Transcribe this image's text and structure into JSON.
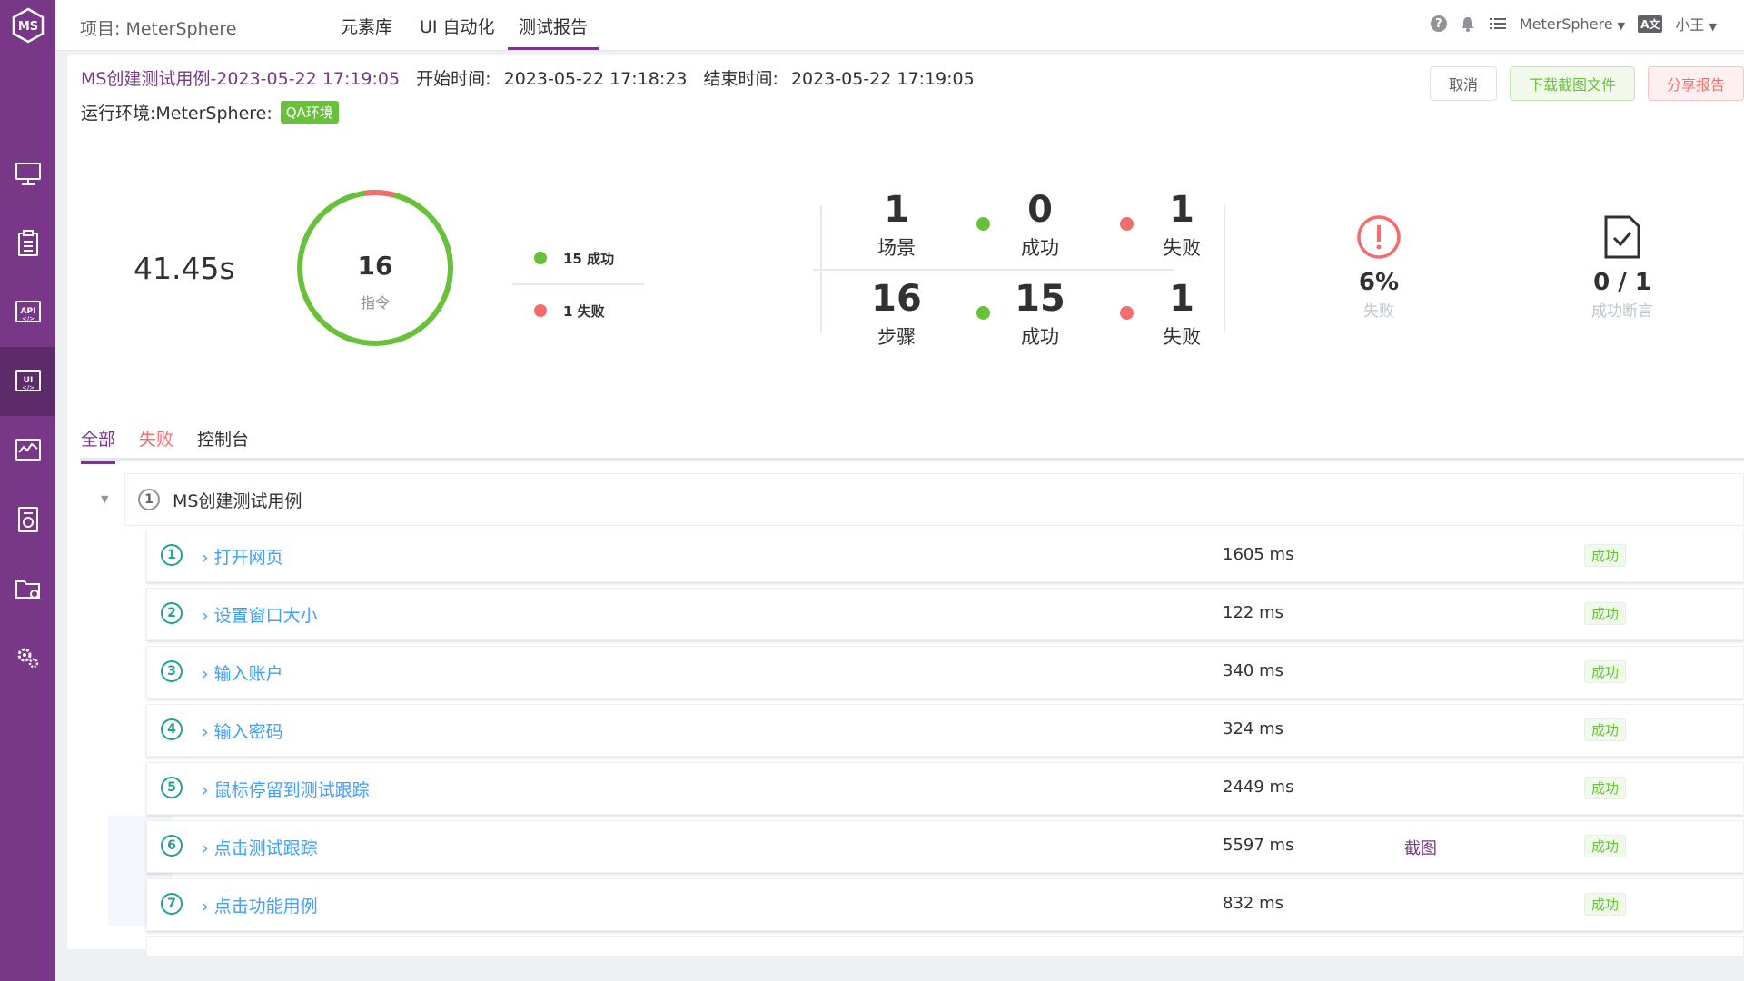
{
  "topbar": {
    "project_label": "项目: MeterSphere",
    "tabs": [
      {
        "label": "元素库",
        "active": false
      },
      {
        "label": "UI 自动化",
        "active": false
      },
      {
        "label": "测试报告",
        "active": true
      }
    ],
    "workspace": "MeterSphere",
    "user": "小王",
    "lang_icon_text": "A文"
  },
  "sidebar": {
    "logo_text": "MS",
    "items": [
      {
        "icon": "monitor-icon"
      },
      {
        "icon": "clipboard-icon"
      },
      {
        "icon": "api-icon",
        "text": "API"
      },
      {
        "icon": "ui-icon",
        "text": "UI",
        "active": true
      },
      {
        "icon": "performance-icon"
      },
      {
        "icon": "report-icon"
      },
      {
        "icon": "folder-settings-icon"
      },
      {
        "icon": "gears-icon"
      }
    ]
  },
  "report": {
    "name": "MS创建测试用例-2023-05-22 17:19:05",
    "start_label": "开始时间:",
    "start_time": "2023-05-22 17:18:23",
    "end_label": "结束时间:",
    "end_time": "2023-05-22 17:19:05",
    "env_label": "运行环境:MeterSphere:",
    "env_tag": "QA环境",
    "buttons": {
      "cancel": "取消",
      "download": "下载截图文件",
      "share": "分享报告"
    }
  },
  "summary": {
    "duration": "41.45s",
    "ring_total": "16",
    "ring_label": "指令",
    "ring_success_fraction": 0.9375,
    "legend": [
      {
        "text": "15 成功",
        "color": "#67c23a"
      },
      {
        "text": "1 失败",
        "color": "#f56c6c"
      }
    ],
    "scenario": {
      "total": "1",
      "total_label": "场景",
      "success": "0",
      "success_label": "成功",
      "fail": "1",
      "fail_label": "失败"
    },
    "steps": {
      "total": "16",
      "total_label": "步骤",
      "success": "15",
      "success_label": "成功",
      "fail": "1",
      "fail_label": "失败"
    },
    "fail_rate": {
      "value": "6%",
      "label": "失败"
    },
    "assertions": {
      "value": "0 / 1",
      "label": "成功断言"
    }
  },
  "result_tabs": [
    {
      "label": "全部",
      "state": "active"
    },
    {
      "label": "失败",
      "state": "fail"
    },
    {
      "label": "控制台",
      "state": "normal"
    }
  ],
  "tree": {
    "root": {
      "num": "1",
      "name": "MS创建测试用例"
    },
    "steps": [
      {
        "num": "1",
        "name": "打开网页",
        "time": "1605 ms",
        "status": "成功",
        "screenshot": ""
      },
      {
        "num": "2",
        "name": "设置窗口大小",
        "time": "122 ms",
        "status": "成功",
        "screenshot": ""
      },
      {
        "num": "3",
        "name": "输入账户",
        "time": "340 ms",
        "status": "成功",
        "screenshot": ""
      },
      {
        "num": "4",
        "name": "输入密码",
        "time": "324 ms",
        "status": "成功",
        "screenshot": ""
      },
      {
        "num": "5",
        "name": "鼠标停留到测试跟踪",
        "time": "2449 ms",
        "status": "成功",
        "screenshot": ""
      },
      {
        "num": "6",
        "name": "点击测试跟踪",
        "time": "5597 ms",
        "status": "成功",
        "screenshot": "截图"
      },
      {
        "num": "7",
        "name": "点击功能用例",
        "time": "832 ms",
        "status": "成功",
        "screenshot": ""
      }
    ]
  }
}
